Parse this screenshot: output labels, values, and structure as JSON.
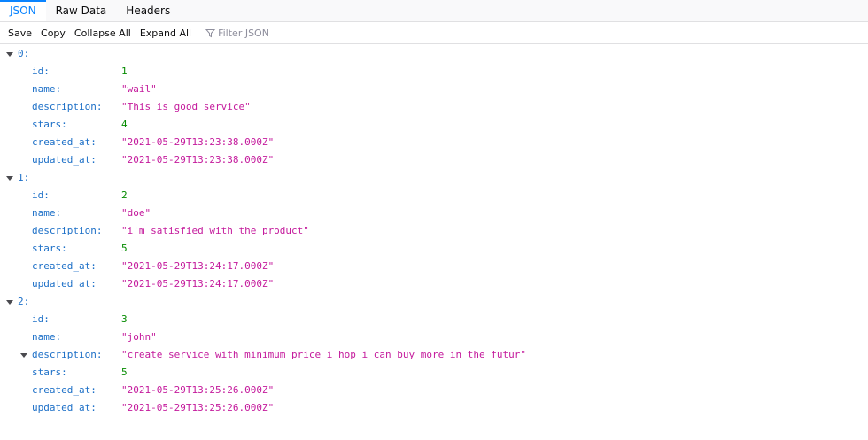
{
  "tabs": [
    {
      "label": "JSON",
      "active": true
    },
    {
      "label": "Raw Data",
      "active": false
    },
    {
      "label": "Headers",
      "active": false
    }
  ],
  "toolbar": {
    "save": "Save",
    "copy": "Copy",
    "collapse_all": "Collapse All",
    "expand_all": "Expand All",
    "filter_placeholder": "Filter JSON"
  },
  "colors": {
    "accent": "#0a84ff",
    "key": "#1c6fc7",
    "string": "#c41a9c",
    "number": "#058b00"
  },
  "records": [
    {
      "index": "0:",
      "fields": [
        {
          "key": "id:",
          "value": "1",
          "kind": "num"
        },
        {
          "key": "name:",
          "value": "\"wail\"",
          "kind": "str"
        },
        {
          "key": "description:",
          "value": "\"This is good service\"",
          "kind": "str"
        },
        {
          "key": "stars:",
          "value": "4",
          "kind": "num"
        },
        {
          "key": "created_at:",
          "value": "\"2021-05-29T13:23:38.000Z\"",
          "kind": "str"
        },
        {
          "key": "updated_at:",
          "value": "\"2021-05-29T13:23:38.000Z\"",
          "kind": "str"
        }
      ]
    },
    {
      "index": "1:",
      "fields": [
        {
          "key": "id:",
          "value": "2",
          "kind": "num"
        },
        {
          "key": "name:",
          "value": "\"doe\"",
          "kind": "str"
        },
        {
          "key": "description:",
          "value": "\"i'm satisfied with the product\"",
          "kind": "str"
        },
        {
          "key": "stars:",
          "value": "5",
          "kind": "num"
        },
        {
          "key": "created_at:",
          "value": "\"2021-05-29T13:24:17.000Z\"",
          "kind": "str"
        },
        {
          "key": "updated_at:",
          "value": "\"2021-05-29T13:24:17.000Z\"",
          "kind": "str"
        }
      ]
    },
    {
      "index": "2:",
      "fields": [
        {
          "key": "id:",
          "value": "3",
          "kind": "num"
        },
        {
          "key": "name:",
          "value": "\"john\"",
          "kind": "str"
        },
        {
          "key": "description:",
          "value": "\"create service with minimum price i hop i can buy more in the futur\"",
          "kind": "str",
          "expandable": true
        },
        {
          "key": "stars:",
          "value": "5",
          "kind": "num"
        },
        {
          "key": "created_at:",
          "value": "\"2021-05-29T13:25:26.000Z\"",
          "kind": "str"
        },
        {
          "key": "updated_at:",
          "value": "\"2021-05-29T13:25:26.000Z\"",
          "kind": "str"
        }
      ]
    }
  ]
}
